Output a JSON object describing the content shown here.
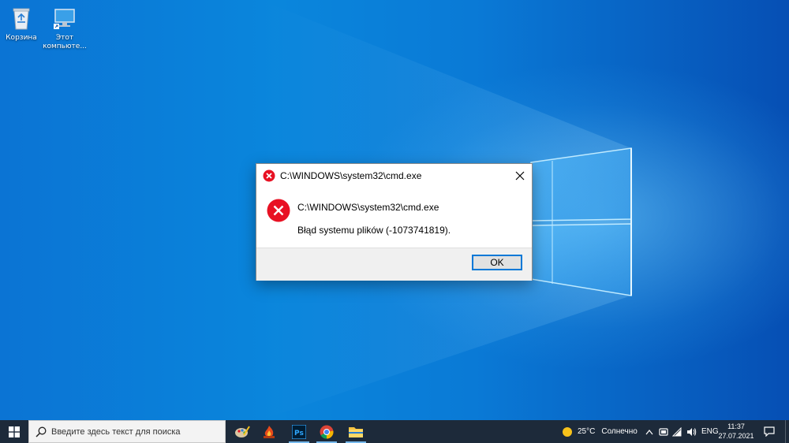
{
  "desktop": {
    "icons": [
      {
        "label": "Корзина",
        "icon": "recycle-bin-icon"
      },
      {
        "label": "Этот компьюте...",
        "icon": "this-pc-icon"
      }
    ]
  },
  "dialog": {
    "title": "C:\\WINDOWS\\system32\\cmd.exe",
    "message_path": "C:\\WINDOWS\\system32\\cmd.exe",
    "message_error": "Błąd systemu plików (-1073741819).",
    "ok_label": "OK",
    "icon": "error-icon"
  },
  "taskbar": {
    "search_placeholder": "Введите здесь текст для поиска",
    "apps": [
      {
        "icon": "paint-tool-icon"
      },
      {
        "icon": "fire-app-icon"
      },
      {
        "icon": "photoshop-icon",
        "label": "Ps"
      },
      {
        "icon": "chrome-icon"
      },
      {
        "icon": "file-explorer-icon"
      }
    ],
    "weather": {
      "temp": "25°C",
      "condition": "Солнечно"
    },
    "language": "ENG",
    "time": "11:37",
    "date": "27.07.2021"
  },
  "colors": {
    "accent": "#0078d7",
    "error_red": "#e81123",
    "taskbar": "#1d2a3a"
  }
}
